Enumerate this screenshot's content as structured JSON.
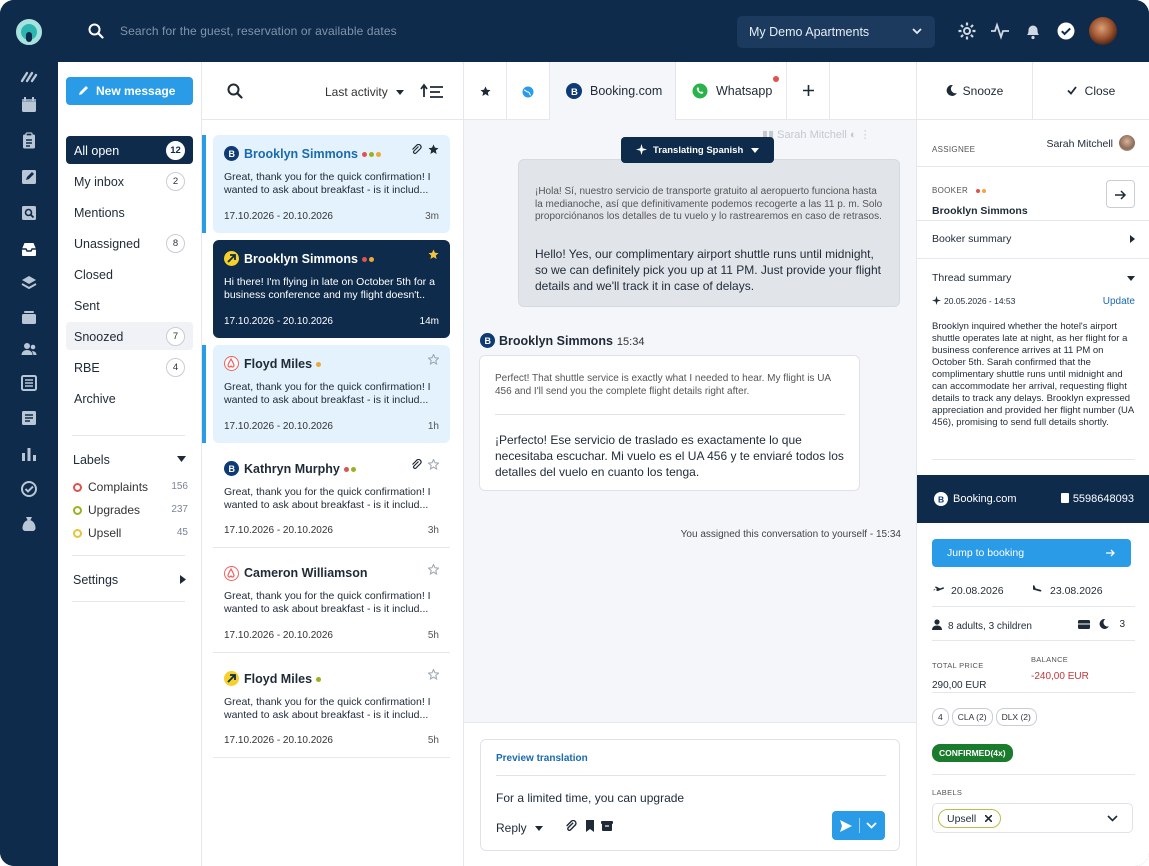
{
  "topbar": {
    "search_placeholder": "Search for the guest, reservation or available dates",
    "property": "My Demo Apartments"
  },
  "nav": {
    "new_message": "New message",
    "folders": [
      {
        "label": "All open",
        "count": "12"
      },
      {
        "label": "My inbox",
        "count": "2"
      },
      {
        "label": "Mentions",
        "count": ""
      },
      {
        "label": "Unassigned",
        "count": "8"
      },
      {
        "label": "Closed",
        "count": ""
      },
      {
        "label": "Sent",
        "count": ""
      },
      {
        "label": "Snoozed",
        "count": "7"
      },
      {
        "label": "RBE",
        "count": "4"
      },
      {
        "label": "Archive",
        "count": ""
      }
    ],
    "labels_title": "Labels",
    "labels": [
      {
        "label": "Complaints",
        "count": "156",
        "color": "#e0524f"
      },
      {
        "label": "Upgrades",
        "count": "237",
        "color": "#9bb11f"
      },
      {
        "label": "Upsell",
        "count": "45",
        "color": "#e6c33a"
      }
    ],
    "settings": "Settings"
  },
  "list": {
    "sort_label": "Last activity",
    "items": [
      {
        "name": "Brooklyn Simmons",
        "preview": "Great, thank you for the quick confirmation! I wanted to ask about breakfast - is it includ...",
        "dates": "17.10.2026 - 20.10.2026",
        "time": "3m",
        "source": "booking"
      },
      {
        "name": "Brooklyn Simmons",
        "preview": "Hi there! I'm flying in late on October 5th for a business conference and my flight doesn't..",
        "dates": "17.10.2026 - 20.10.2026",
        "time": "14m",
        "source": "expedia"
      },
      {
        "name": "Floyd Miles",
        "preview": "Great, thank you for the quick confirmation! I wanted to ask about breakfast - is it includ...",
        "dates": "17.10.2026 - 20.10.2026",
        "time": "1h",
        "source": "airbnb"
      },
      {
        "name": "Kathryn Murphy",
        "preview": "Great, thank you for the quick confirmation! I wanted to ask about breakfast - is it includ...",
        "dates": "17.10.2026 - 20.10.2026",
        "time": "3h",
        "source": "booking"
      },
      {
        "name": "Cameron Williamson",
        "preview": "Great, thank you for the quick confirmation! I wanted to ask about breakfast - is it includ...",
        "dates": "17.10.2026 - 20.10.2026",
        "time": "5h",
        "source": "airbnb"
      },
      {
        "name": "Floyd Miles",
        "preview": "Great, thank you for the quick confirmation! I wanted to ask about breakfast - is it includ...",
        "dates": "17.10.2026 - 20.10.2026",
        "time": "5h",
        "source": "expedia"
      }
    ]
  },
  "conversation": {
    "tabs": {
      "booking": "Booking.com",
      "whatsapp": "Whatsapp"
    },
    "translating": "Translating Spanish",
    "ghost_sender": "Sarah Mitchell",
    "outgoing": {
      "original": "¡Hola! Sí, nuestro servicio de transporte gratuito al aeropuerto funciona hasta la medianoche, así que definitivamente podemos recogerte a las 11 p. m. Solo proporciónanos los detalles de tu vuelo y lo rastrearemos en caso de retrasos.",
      "translation": "Hello! Yes, our complimentary airport shuttle runs until midnight, so we can definitely pick you up at 11 PM. Just provide your flight details and we'll track it in case of delays."
    },
    "incoming": {
      "sender": "Brooklyn Simmons",
      "time": "15:34",
      "original": "Perfect! That shuttle service is exactly what I needed to hear. My flight is UA 456 and I'll send you the complete flight details right after.",
      "translation": "¡Perfecto! Ese servicio de traslado es exactamente lo que necesitaba escuchar. Mi vuelo es el UA 456 y te enviaré todos los detalles del vuelo en cuanto los tenga."
    },
    "system": "You assigned this conversation to yourself - 15:34",
    "composer": {
      "preview_translation": "Preview translation",
      "text": "For a limited time, you can upgrade",
      "reply": "Reply"
    }
  },
  "details": {
    "snooze": "Snooze",
    "close": "Close",
    "assignee_label": "ASSIGNEE",
    "assignee": "Sarah Mitchell",
    "booker_label": "BOOKER",
    "booker": "Brooklyn Simmons",
    "booker_summary": "Booker summary",
    "thread_summary": "Thread summary",
    "summary_time": "20.05.2026 - 14:53",
    "update": "Update",
    "summary": "Brooklyn inquired whether the hotel's airport shuttle operates late at night, as her flight for a business conference arrives at 11 PM on October 5th. Sarah confirmed that the complimentary shuttle runs until midnight and can accommodate her arrival, requesting flight details to track any delays. Brooklyn expressed appreciation and provided her flight number (UA 456), promising to send full details shortly.",
    "booking_source": "Booking.com",
    "booking_id": "5598648093",
    "jump": "Jump to booking",
    "arrival": "20.08.2026",
    "departure": "23.08.2026",
    "guests": "8 adults, 3 children",
    "nights": "3",
    "total_label": "TOTAL PRICE",
    "total": "290,00 EUR",
    "balance_label": "BALANCE",
    "balance": "-240,00 EUR",
    "chips": [
      "4",
      "CLA (2)",
      "DLX (2)"
    ],
    "confirmed": "CONFIRMED(4x)",
    "labels_label": "LABELS",
    "label_value": "Upsell"
  }
}
